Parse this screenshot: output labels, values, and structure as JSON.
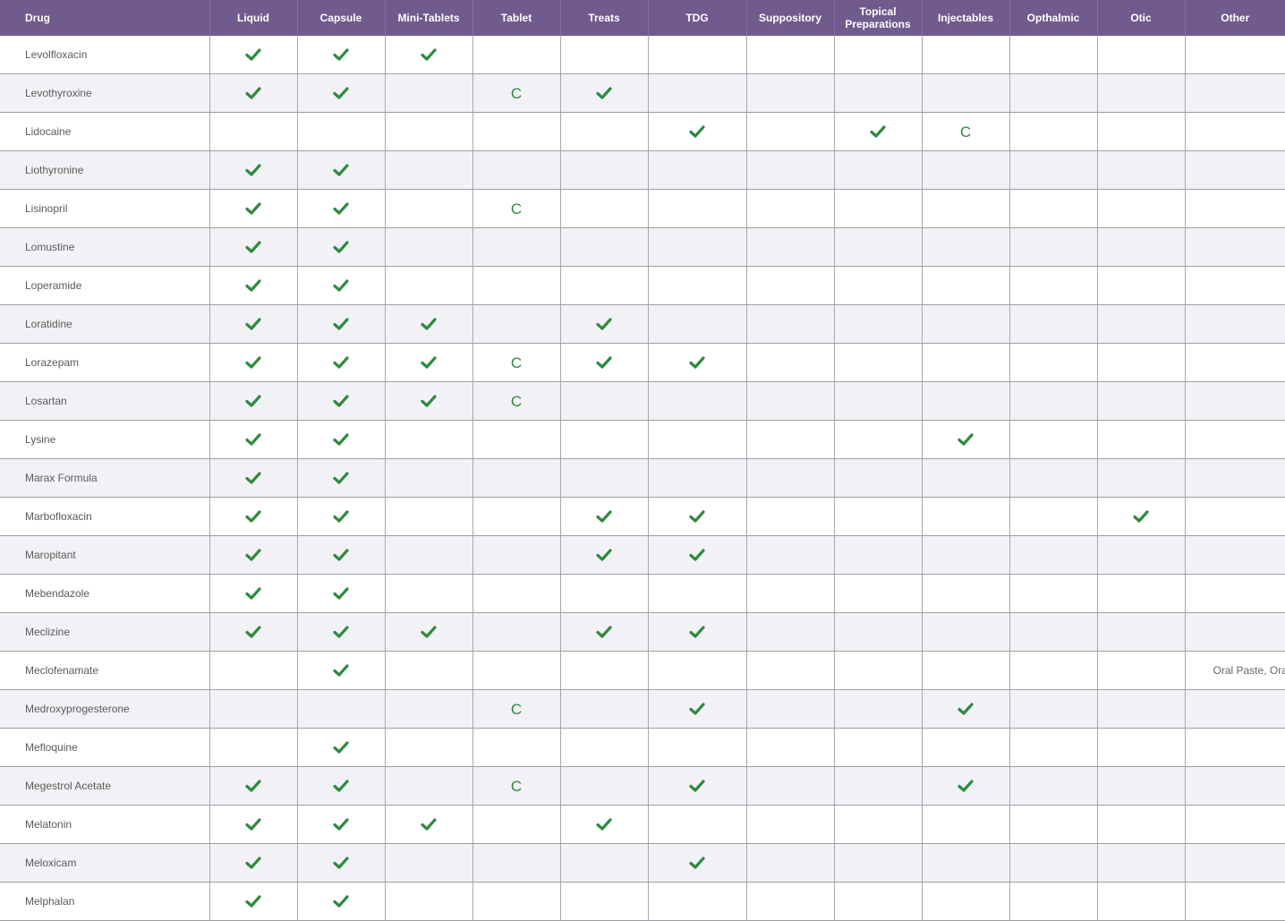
{
  "columns": [
    "Drug",
    "Liquid",
    "Capsule",
    "Mini-Tablets",
    "Tablet",
    "Treats",
    "TDG",
    "Suppository",
    "Topical Preparations",
    "Injectables",
    "Opthalmic",
    "Otic",
    "Other"
  ],
  "marks": {
    "check": "✔",
    "compounded": "C",
    "check_color": "#2f8a3f"
  },
  "rows": [
    {
      "drug": "Levolfloxacin",
      "cells": [
        "check",
        "check",
        "check",
        "",
        "",
        "",
        "",
        "",
        "",
        "",
        "",
        ""
      ]
    },
    {
      "drug": "Levothyroxine",
      "cells": [
        "check",
        "check",
        "",
        "C",
        "check",
        "",
        "",
        "",
        "",
        "",
        "",
        ""
      ]
    },
    {
      "drug": "Lidocaine",
      "cells": [
        "",
        "",
        "",
        "",
        "",
        "check",
        "",
        "check",
        "C",
        "",
        "",
        ""
      ]
    },
    {
      "drug": "Liothyronine",
      "cells": [
        "check",
        "check",
        "",
        "",
        "",
        "",
        "",
        "",
        "",
        "",
        "",
        ""
      ]
    },
    {
      "drug": "Lisinopril",
      "cells": [
        "check",
        "check",
        "",
        "C",
        "",
        "",
        "",
        "",
        "",
        "",
        "",
        ""
      ]
    },
    {
      "drug": "Lomustine",
      "cells": [
        "check",
        "check",
        "",
        "",
        "",
        "",
        "",
        "",
        "",
        "",
        "",
        ""
      ]
    },
    {
      "drug": "Loperamide",
      "cells": [
        "check",
        "check",
        "",
        "",
        "",
        "",
        "",
        "",
        "",
        "",
        "",
        ""
      ]
    },
    {
      "drug": "Loratidine",
      "cells": [
        "check",
        "check",
        "check",
        "",
        "check",
        "",
        "",
        "",
        "",
        "",
        "",
        ""
      ]
    },
    {
      "drug": "Lorazepam",
      "cells": [
        "check",
        "check",
        "check",
        "C",
        "check",
        "check",
        "",
        "",
        "",
        "",
        "",
        ""
      ]
    },
    {
      "drug": "Losartan",
      "cells": [
        "check",
        "check",
        "check",
        "C",
        "",
        "",
        "",
        "",
        "",
        "",
        "",
        ""
      ]
    },
    {
      "drug": "Lysine",
      "cells": [
        "check",
        "check",
        "",
        "",
        "",
        "",
        "",
        "",
        "check",
        "",
        "",
        ""
      ]
    },
    {
      "drug": "Marax Formula",
      "cells": [
        "check",
        "check",
        "",
        "",
        "",
        "",
        "",
        "",
        "",
        "",
        "",
        ""
      ]
    },
    {
      "drug": "Marbofloxacin",
      "cells": [
        "check",
        "check",
        "",
        "",
        "check",
        "check",
        "",
        "",
        "",
        "",
        "check",
        ""
      ]
    },
    {
      "drug": "Maropitant",
      "cells": [
        "check",
        "check",
        "",
        "",
        "check",
        "check",
        "",
        "",
        "",
        "",
        "",
        ""
      ]
    },
    {
      "drug": "Mebendazole",
      "cells": [
        "check",
        "check",
        "",
        "",
        "",
        "",
        "",
        "",
        "",
        "",
        "",
        ""
      ]
    },
    {
      "drug": "Meclizine",
      "cells": [
        "check",
        "check",
        "check",
        "",
        "check",
        "check",
        "",
        "",
        "",
        "",
        "",
        ""
      ]
    },
    {
      "drug": "Meclofenamate",
      "cells": [
        "",
        "check",
        "",
        "",
        "",
        "",
        "",
        "",
        "",
        "",
        "",
        "Oral Paste, Ora"
      ]
    },
    {
      "drug": "Medroxyprogesterone",
      "cells": [
        "",
        "",
        "",
        "C",
        "",
        "check",
        "",
        "",
        "check",
        "",
        "",
        ""
      ]
    },
    {
      "drug": "Mefloquine",
      "cells": [
        "",
        "check",
        "",
        "",
        "",
        "",
        "",
        "",
        "",
        "",
        "",
        ""
      ]
    },
    {
      "drug": "Megestrol Acetate",
      "cells": [
        "check",
        "check",
        "",
        "C",
        "",
        "check",
        "",
        "",
        "check",
        "",
        "",
        ""
      ]
    },
    {
      "drug": "Melatonin",
      "cells": [
        "check",
        "check",
        "check",
        "",
        "check",
        "",
        "",
        "",
        "",
        "",
        "",
        ""
      ]
    },
    {
      "drug": "Meloxicam",
      "cells": [
        "check",
        "check",
        "",
        "",
        "",
        "check",
        "",
        "",
        "",
        "",
        "",
        ""
      ]
    },
    {
      "drug": "Melphalan",
      "cells": [
        "check",
        "check",
        "",
        "",
        "",
        "",
        "",
        "",
        "",
        "",
        "",
        ""
      ]
    }
  ]
}
